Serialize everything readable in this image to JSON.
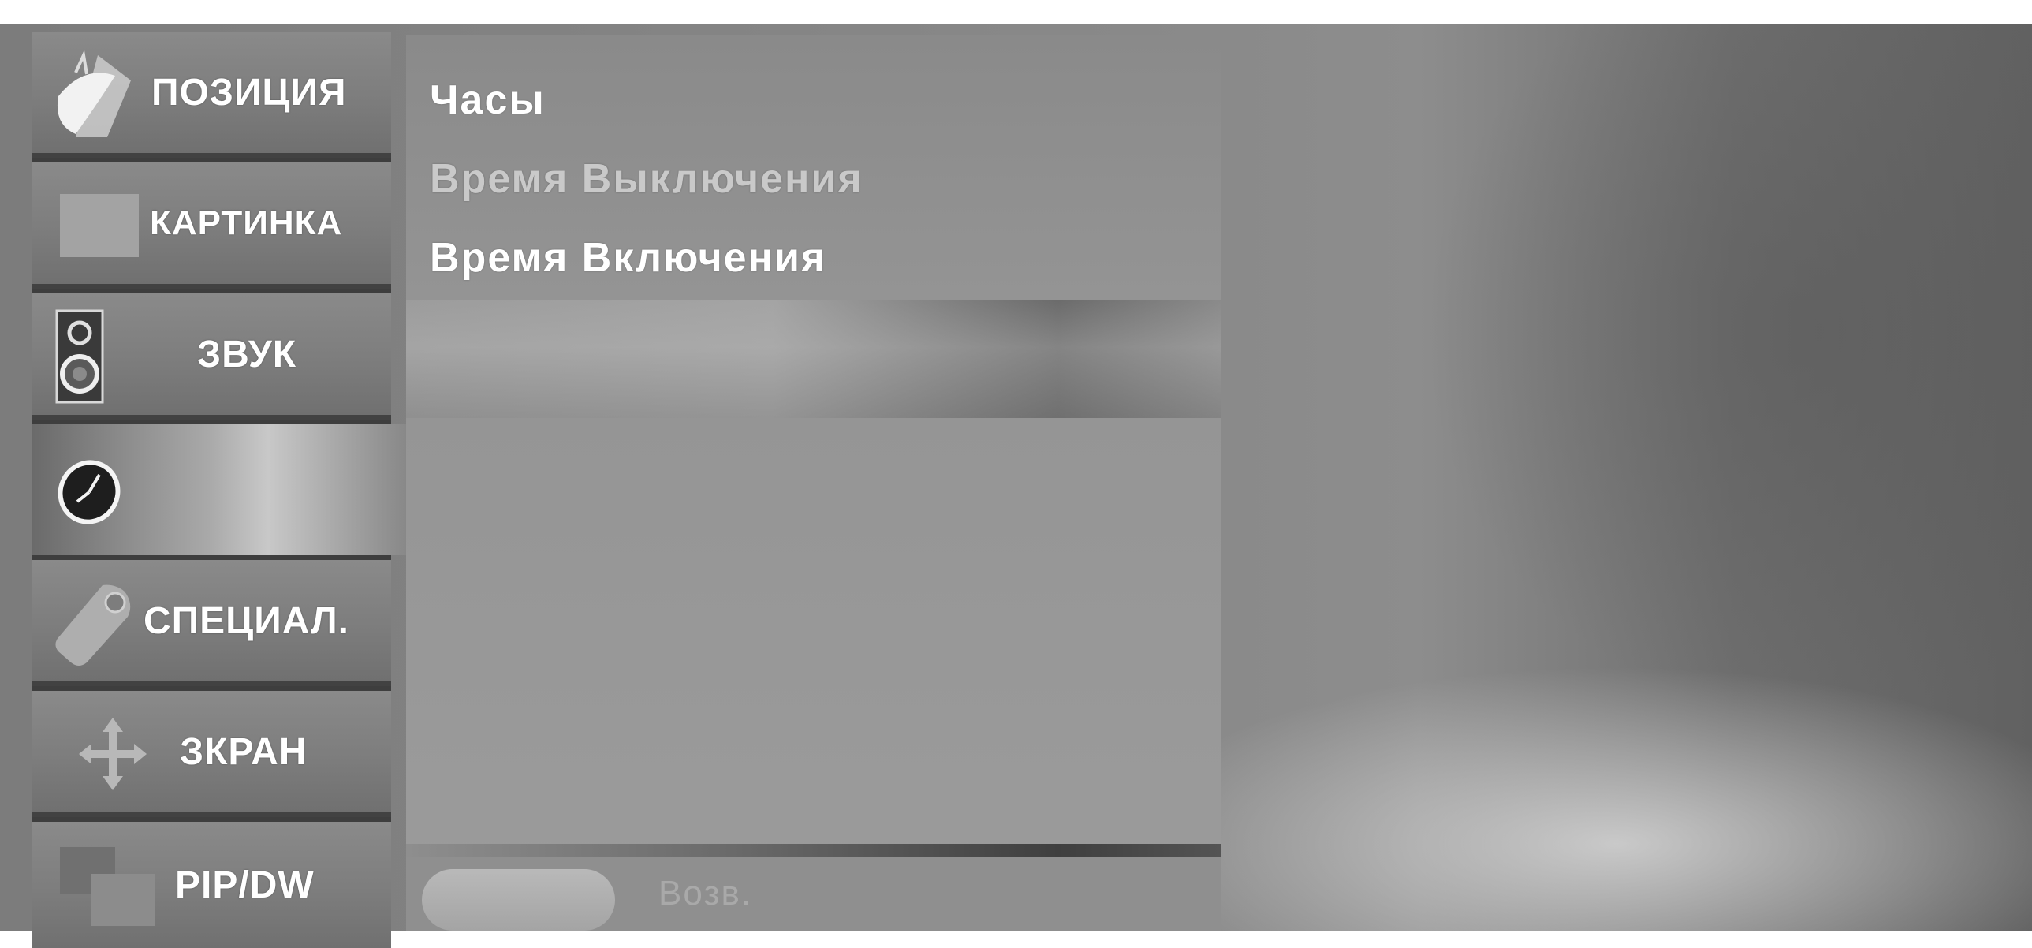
{
  "sidebar": {
    "items": [
      {
        "label": "ПОЗИЦИЯ",
        "icon": "satellite-dish-icon"
      },
      {
        "label": "КАРТИНКА",
        "icon": "picture-icon"
      },
      {
        "label": "ЗВУК",
        "icon": "speaker-icon"
      },
      {
        "label": "",
        "icon": "clock-icon",
        "active": true
      },
      {
        "label": "СПЕЦИАЛ.",
        "icon": "tag-icon"
      },
      {
        "label": "ЗКРАН",
        "icon": "move-arrows-icon"
      },
      {
        "label": "PIP/DW",
        "icon": "pip-icon"
      }
    ]
  },
  "menu": {
    "items": [
      {
        "label": "Часы"
      },
      {
        "label": "Время Выключения"
      },
      {
        "label": "Время Включения"
      }
    ]
  },
  "footer": {
    "return_label": "Возв."
  },
  "colors": {
    "sidebar_bg": "#3e3e3e",
    "panel_bg": "#959595",
    "text": "#ffffff"
  }
}
